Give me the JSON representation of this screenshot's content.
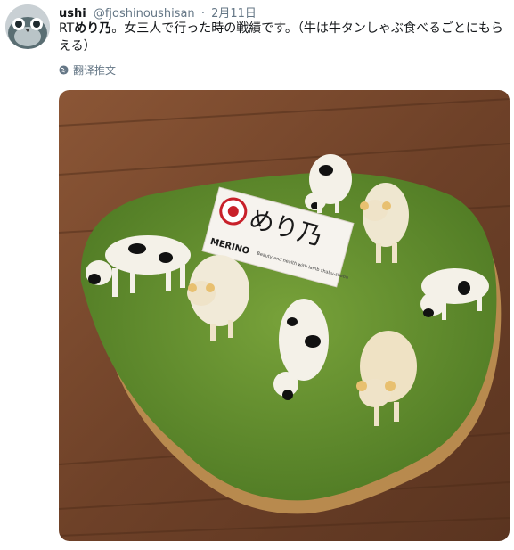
{
  "user": {
    "display_name": "ushi",
    "handle": "@fjoshinoushisan",
    "separator": "·",
    "date": "2月11日"
  },
  "tweet": {
    "prefix": "RT",
    "bold_name": "めり乃",
    "text": "。女三人で行った時の戦績です。（牛は牛タンしゃぶ食べるごとにもらえる）"
  },
  "translate_label": "翻译推文",
  "icons": {
    "avatar": "bird-avatar-icon",
    "translate": "globe-icon"
  },
  "photo": {
    "sign_logo": "めり乃",
    "sign_brand": "MERINO",
    "sign_subtext": "Beauty and health with lamb shabu-shabu",
    "colors": {
      "wood": "#7a4a2e",
      "grass": "#5f8a2c",
      "cork": "#b88a4e"
    }
  }
}
